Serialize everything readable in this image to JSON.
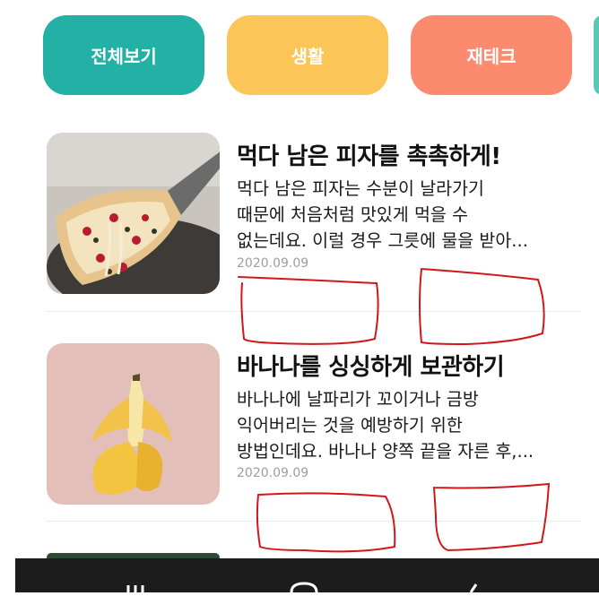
{
  "categories": [
    {
      "label": "전체보기",
      "color": "#23b0a5"
    },
    {
      "label": "생활",
      "color": "#fbc657"
    },
    {
      "label": "재테크",
      "color": "#fb8a6e"
    }
  ],
  "articles": [
    {
      "title": "먹다 남은 피자를 촉촉하게!",
      "desc_lines": [
        "먹다 남은 피자는 수분이 날라가기",
        "때문에 처음처럼 맛있게 먹을 수",
        "없는데요. 이럴 경우 그릇에 물을 받아..."
      ],
      "date": "2020.09.09",
      "thumb_icon": "pizza-image"
    },
    {
      "title": "바나나를 싱싱하게 보관하기",
      "desc_lines": [
        "바나나에 날파리가 꼬이거나 금방",
        "익어버리는 것을 예방하기 위한",
        "방법인데요. 바나나 양쪽 끝을 자른 후,..."
      ],
      "date": "2020.09.09",
      "thumb_icon": "banana-image"
    }
  ],
  "annotation_color": "#d0181b"
}
